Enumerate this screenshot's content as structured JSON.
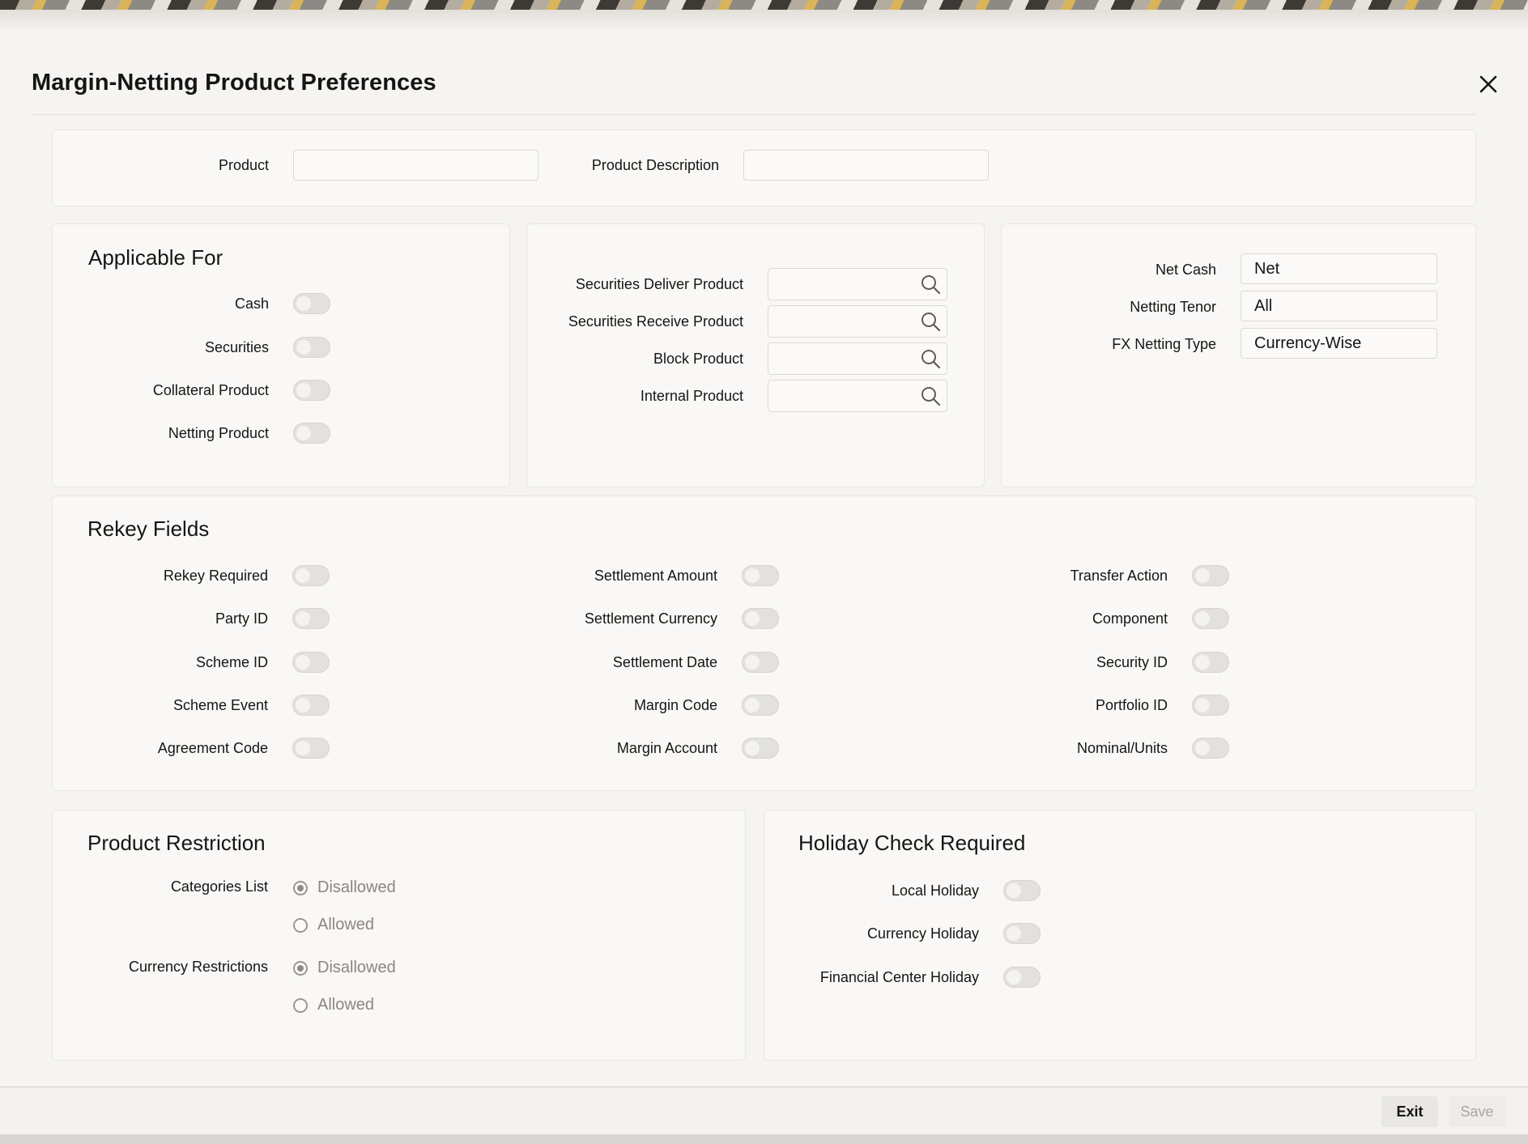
{
  "window": {
    "title": "Margin-Netting Product Preferences"
  },
  "header": {
    "product_label": "Product",
    "product_value": "",
    "product_desc_label": "Product Description",
    "product_desc_value": ""
  },
  "applicable_for": {
    "heading": "Applicable For",
    "items": [
      {
        "label": "Cash",
        "on": false
      },
      {
        "label": "Securities",
        "on": false
      },
      {
        "label": "Collateral Product",
        "on": false
      },
      {
        "label": "Netting Product",
        "on": false
      }
    ]
  },
  "products": {
    "items": [
      {
        "label": "Securities Deliver Product",
        "value": ""
      },
      {
        "label": "Securities Receive Product",
        "value": ""
      },
      {
        "label": "Block Product",
        "value": ""
      },
      {
        "label": "Internal Product",
        "value": ""
      }
    ]
  },
  "netting": {
    "net_cash_label": "Net Cash",
    "net_cash_value": "Net",
    "netting_tenor_label": "Netting Tenor",
    "netting_tenor_value": "All",
    "fx_netting_type_label": "FX Netting Type",
    "fx_netting_type_value": "Currency-Wise"
  },
  "rekey": {
    "heading": "Rekey Fields",
    "col1": [
      "Rekey Required",
      "Party ID",
      "Scheme ID",
      "Scheme Event",
      "Agreement Code"
    ],
    "col2": [
      "Settlement Amount",
      "Settlement Currency",
      "Settlement Date",
      "Margin Code",
      "Margin Account"
    ],
    "col3": [
      "Transfer Action",
      "Component",
      "Security ID",
      "Portfolio ID",
      "Nominal/Units"
    ]
  },
  "restriction": {
    "heading": "Product Restriction",
    "categories_label": "Categories List",
    "currency_label": "Currency Restrictions",
    "opt_disallowed": "Disallowed",
    "opt_allowed": "Allowed",
    "categories_selected": "Disallowed",
    "currency_selected": "Disallowed"
  },
  "holiday": {
    "heading": "Holiday Check Required",
    "items": [
      "Local Holiday",
      "Currency Holiday",
      "Financial Center Holiday"
    ]
  },
  "footer": {
    "exit_label": "Exit",
    "save_label": "Save"
  },
  "icons": {
    "close": "close-icon",
    "search": "search-icon"
  }
}
